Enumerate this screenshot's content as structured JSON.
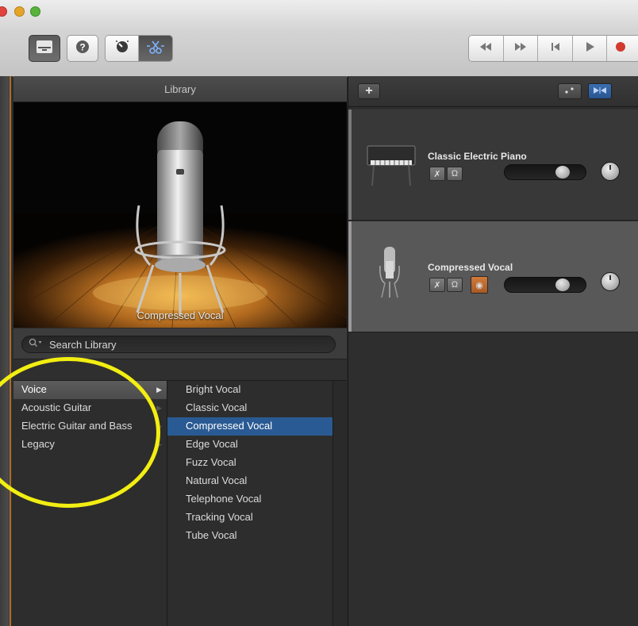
{
  "library": {
    "title": "Library",
    "preview_caption": "Compressed Vocal",
    "search": {
      "placeholder": "Search Library",
      "value": ""
    },
    "categories": [
      {
        "label": "Voice"
      },
      {
        "label": "Acoustic Guitar"
      },
      {
        "label": "Electric Guitar and Bass"
      },
      {
        "label": "Legacy"
      }
    ],
    "patches": [
      {
        "label": "Bright Vocal"
      },
      {
        "label": "Classic Vocal"
      },
      {
        "label": "Compressed Vocal"
      },
      {
        "label": "Edge Vocal"
      },
      {
        "label": "Fuzz Vocal"
      },
      {
        "label": "Natural Vocal"
      },
      {
        "label": "Telephone Vocal"
      },
      {
        "label": "Tracking Vocal"
      },
      {
        "label": "Tube Vocal"
      }
    ],
    "selected_category": "Voice",
    "selected_patch": "Compressed Vocal"
  },
  "tracks": [
    {
      "name": "Classic Electric Piano",
      "volume": 0.7
    },
    {
      "name": "Compressed Vocal",
      "volume": 0.7,
      "record_enabled": true
    }
  ],
  "toolbar": {
    "add_track_label": "+"
  },
  "colors": {
    "selection_blue": "#2a5a93",
    "annotation_yellow": "#f2ee12",
    "record_orange": "#c46e2f"
  }
}
